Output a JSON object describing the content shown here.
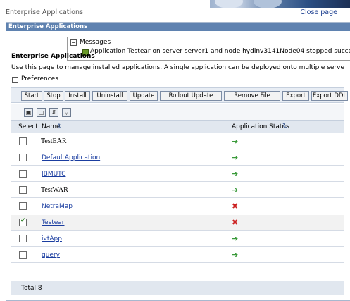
{
  "header": {
    "page_title": "Enterprise Applications",
    "close_link": "Close page"
  },
  "frame": {
    "title": "Enterprise Applications"
  },
  "messages": {
    "toggle": "−",
    "title": "Messages",
    "text": "Application Testear on server server1 and node hydlnv3141Node04 stopped succe"
  },
  "section": {
    "title": "Enterprise Applications",
    "description": "Use this page to manage installed applications. A single application can be deployed onto multiple serve",
    "preferences_toggle": "+",
    "preferences_label": "Preferences"
  },
  "toolbar": {
    "buttons": [
      "Start",
      "Stop",
      "Install",
      "Uninstall",
      "Update",
      "Rollout Update",
      "Remove File",
      "Export",
      "Export DDL"
    ]
  },
  "table": {
    "headers": {
      "select": "Select",
      "name": "Name",
      "status": "Application Status"
    },
    "rows": [
      {
        "name": "TestEAR",
        "status": "started",
        "checked": false
      },
      {
        "name": "DefaultApplication",
        "status": "started",
        "checked": false
      },
      {
        "name": "IBMUTC",
        "status": "started",
        "checked": false
      },
      {
        "name": "TestWAR",
        "status": "started",
        "checked": false
      },
      {
        "name": "NetraMap",
        "status": "stopped",
        "checked": false
      },
      {
        "name": "Testear",
        "status": "stopped",
        "checked": true
      },
      {
        "name": "ivtApp",
        "status": "started",
        "checked": false
      },
      {
        "name": "query",
        "status": "started",
        "checked": false
      }
    ],
    "total": "Total 8"
  },
  "icons": {
    "status_started": "green-arrow-icon",
    "status_stopped": "red-x-icon"
  },
  "colors": {
    "header_bar": "#5f82b0",
    "link": "#1a3da0",
    "started": "#3a9a3a",
    "stopped": "#cc2222"
  }
}
